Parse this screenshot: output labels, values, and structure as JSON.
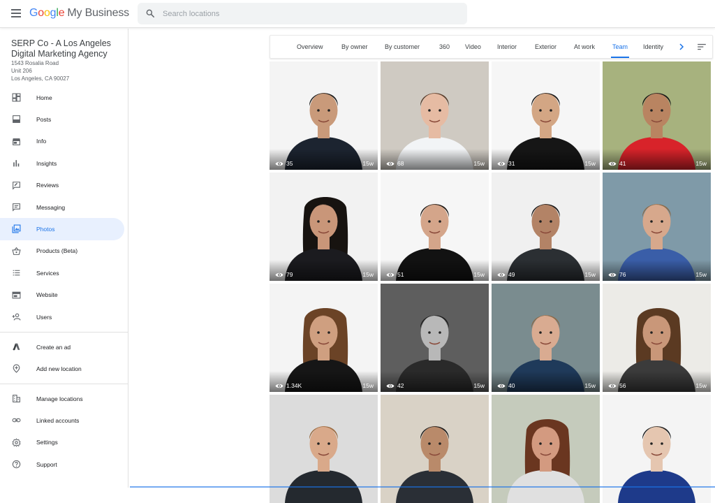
{
  "app": {
    "logo_google": "Google",
    "logo_product": "My Business"
  },
  "search": {
    "placeholder": "Search locations"
  },
  "business": {
    "name": "SERP Co - A Los Angeles Digital Marketing Agency",
    "address_lines": [
      "1543 Rosalia Road",
      "Unit 206",
      "Los Angeles, CA 90027"
    ]
  },
  "nav": [
    {
      "label": "Home",
      "icon": "dashboard-icon",
      "active": false
    },
    {
      "label": "Posts",
      "icon": "posts-icon",
      "active": false
    },
    {
      "label": "Info",
      "icon": "store-icon",
      "active": false
    },
    {
      "label": "Insights",
      "icon": "bar-chart-icon",
      "active": false
    },
    {
      "label": "Reviews",
      "icon": "reviews-icon",
      "active": false
    },
    {
      "label": "Messaging",
      "icon": "message-icon",
      "active": false
    },
    {
      "label": "Photos",
      "icon": "photos-icon",
      "active": true
    },
    {
      "label": "Products (Beta)",
      "icon": "basket-icon",
      "active": false
    },
    {
      "label": "Services",
      "icon": "list-icon",
      "active": false
    },
    {
      "label": "Website",
      "icon": "website-icon",
      "active": false
    },
    {
      "label": "Users",
      "icon": "add-user-icon",
      "active": false
    }
  ],
  "nav_secondary": [
    {
      "label": "Create an ad",
      "icon": "ads-icon"
    },
    {
      "label": "Add new location",
      "icon": "add-location-icon"
    }
  ],
  "nav_tertiary": [
    {
      "label": "Manage locations",
      "icon": "building-icon"
    },
    {
      "label": "Linked accounts",
      "icon": "link-icon"
    },
    {
      "label": "Settings",
      "icon": "gear-icon"
    },
    {
      "label": "Support",
      "icon": "help-icon"
    }
  ],
  "tabs": [
    {
      "label": "Overview",
      "active": false
    },
    {
      "label": "By owner",
      "active": false
    },
    {
      "label": "By customer",
      "active": false
    },
    {
      "label": "360",
      "active": false
    },
    {
      "label": "Video",
      "active": false
    },
    {
      "label": "Interior",
      "active": false
    },
    {
      "label": "Exterior",
      "active": false
    },
    {
      "label": "At work",
      "active": false
    },
    {
      "label": "Team",
      "active": true
    },
    {
      "label": "Identity",
      "active": false
    }
  ],
  "photos": [
    {
      "views": "35",
      "age": "15w",
      "bg": "#f4f4f4",
      "shirt": "#1c2430",
      "skin": "#c99a7a",
      "hair": "#1a1a1a"
    },
    {
      "views": "68",
      "age": "15w",
      "bg": "#cfcac2",
      "shirt": "#f2f4f6",
      "skin": "#e6bba3",
      "hair": "#5a3d2b"
    },
    {
      "views": "31",
      "age": "15w",
      "bg": "#f6f6f6",
      "shirt": "#161616",
      "skin": "#d3a684",
      "hair": "#141414"
    },
    {
      "views": "41",
      "age": "15w",
      "bg": "#a7b27e",
      "shirt": "#d8232a",
      "skin": "#b98461",
      "hair": "#141414"
    },
    {
      "views": "79",
      "age": "15w",
      "bg": "#f2f2f2",
      "shirt": "#1b1b1f",
      "skin": "#c99679",
      "hair": "#171310"
    },
    {
      "views": "51",
      "age": "15w",
      "bg": "#f6f6f6",
      "shirt": "#121212",
      "skin": "#d4a58a",
      "hair": "#1d1712"
    },
    {
      "views": "49",
      "age": "15w",
      "bg": "#f0f0f0",
      "shirt": "#2b2f33",
      "skin": "#b38366",
      "hair": "#141414"
    },
    {
      "views": "76",
      "age": "15w",
      "bg": "#7f9aa8",
      "shirt": "#3a5ea8",
      "skin": "#d7a88c",
      "hair": "#8a6a4a"
    },
    {
      "views": "1.34K",
      "age": "15w",
      "bg": "#f4f4f4",
      "shirt": "#161616",
      "skin": "#cf9f80",
      "hair": "#6b4326"
    },
    {
      "views": "42",
      "age": "15w",
      "bg": "#5e5e5e",
      "shirt": "#2a2a2a",
      "skin": "#b8b8b8",
      "hair": "#1e1e1e"
    },
    {
      "views": "40",
      "age": "15w",
      "bg": "#7a8c8f",
      "shirt": "#1f3a5a",
      "skin": "#d9ab91",
      "hair": "#8a6a4a"
    },
    {
      "views": "56",
      "age": "15w",
      "bg": "#ecebe7",
      "shirt": "#3b3b3b",
      "skin": "#c99779",
      "hair": "#5b3a22"
    },
    {
      "views": "",
      "age": "",
      "bg": "#dcdcdc",
      "shirt": "#24292f",
      "skin": "#d9a98a",
      "hair": "#9a6a40"
    },
    {
      "views": "",
      "age": "",
      "bg": "#d9d2c6",
      "shirt": "#2a2f36",
      "skin": "#b98a6a",
      "hair": "#1a1a1a"
    },
    {
      "views": "",
      "age": "",
      "bg": "#c5cbbc",
      "shirt": "#e0e0e0",
      "skin": "#d39a80",
      "hair": "#6a3620"
    },
    {
      "views": "",
      "age": "",
      "bg": "#f4f4f4",
      "shirt": "#1e3a8a",
      "skin": "#e5c6b0",
      "hair": "#1c1c1c"
    }
  ],
  "colors": {
    "accent": "#1a73e8",
    "active_bg": "#e8f0fe"
  }
}
